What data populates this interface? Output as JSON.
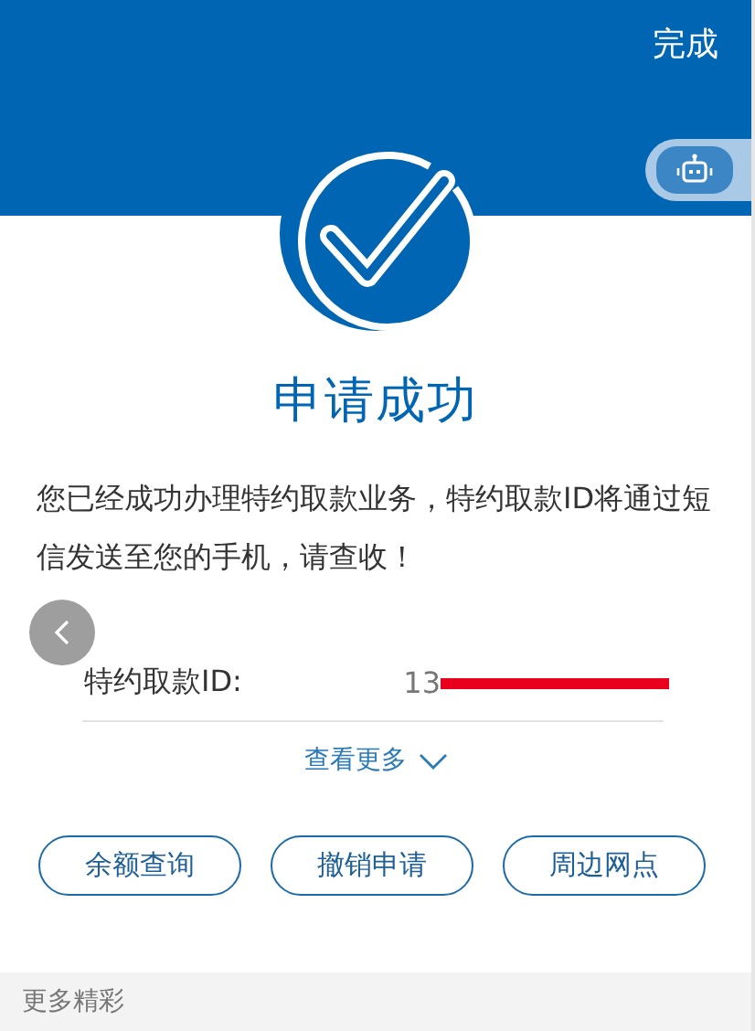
{
  "header": {
    "done_button": "完成"
  },
  "result": {
    "title": "申请成功",
    "message": "您已经成功办理特约取款业务，特约取款ID将通过短信发送至您的手机，请查收！"
  },
  "detail": {
    "label": "特约取款ID:",
    "value": "13",
    "redacted": true,
    "more_link": "查看更多"
  },
  "buttons": [
    "余额查询",
    "撤销申请",
    "周边网点"
  ],
  "footer": {
    "title": "更多精彩"
  }
}
